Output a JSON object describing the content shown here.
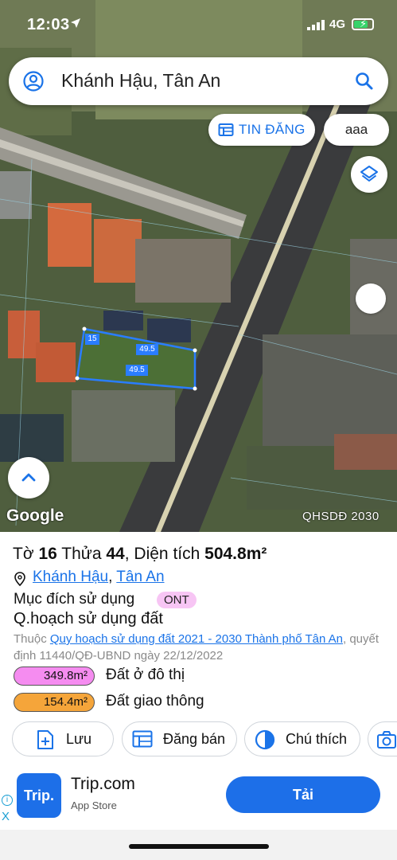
{
  "status_bar": {
    "time": "12:03",
    "network": "4G"
  },
  "search": {
    "text": "Khánh Hậu, Tân An"
  },
  "map_chips": {
    "tin_dang": "TIN ĐĂNG",
    "aaa": "aaa"
  },
  "map_labels": {
    "edge_side": "15",
    "edge_top": "49.5",
    "edge_bottom": "49.5",
    "google": "Google",
    "layer_name": "QHSDĐ 2030"
  },
  "parcel": {
    "to_label": "Tờ",
    "to_value": "16",
    "thua_label": "Thửa",
    "thua_value": "44",
    "area_label": "Diện tích",
    "area_value": "504.8m²",
    "ward": "Khánh Hậu",
    "separator": ",",
    "city": "Tân An",
    "purpose_label": "Mục đích sử dụng",
    "purpose_code": "ONT",
    "planning_title": "Q.hoạch sử dụng đất",
    "belongs_prefix": "Thuộc",
    "plan_link": "Quy hoạch sử dụng đất 2021 - 2030 Thành phố Tân An",
    "decision_text": ", quyết định 11440/QĐ-UBND ngày 22/12/2022",
    "legend": [
      {
        "area": "349.8m²",
        "name": "Đất ở đô thị",
        "color": "#f58cf0"
      },
      {
        "area": "154.4m²",
        "name": "Đất giao thông",
        "color": "#f5a53a"
      }
    ]
  },
  "actions": [
    {
      "label": "Lưu",
      "icon": "save-add-icon"
    },
    {
      "label": "Đăng bán",
      "icon": "listing-icon"
    },
    {
      "label": "Chú thích",
      "icon": "legend-contrast-icon"
    },
    {
      "label": "",
      "icon": "camera-icon"
    }
  ],
  "ad": {
    "logo": "Trip.",
    "name": "Trip.com",
    "store": "App Store",
    "cta": "Tải",
    "info": "i",
    "close": "X"
  },
  "colors": {
    "accent": "#1a73e8",
    "ad_blue": "#1d6fe8",
    "parcel_outline": "#2a7dff"
  }
}
